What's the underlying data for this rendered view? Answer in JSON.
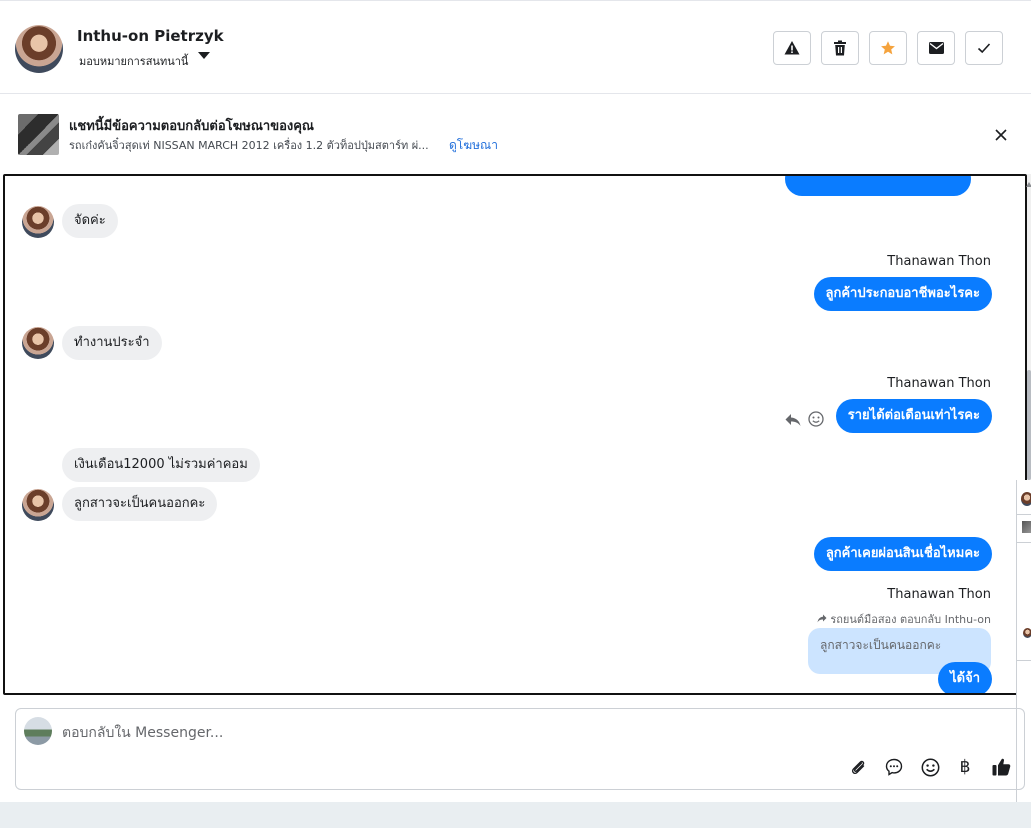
{
  "header": {
    "contact_name": "Inthu-on Pietrzyk",
    "assign_label": "มอบหมายการสนทนานี้",
    "actions": [
      "mark-spam",
      "delete",
      "star",
      "mark-unread",
      "mark-done"
    ],
    "star_color": "#f5a33d"
  },
  "ad": {
    "title": "แชทนี้มีข้อความตอบกลับต่อโฆษณาของคุณ",
    "description": "รถเก๋งคันจิ๋วสุดเท่ NISSAN MARCH 2012 เครื่อง 1.2 ตัวท็อปปุ่มสตาร์ท ผ่...",
    "link_label": "ดูโฆษณา"
  },
  "messages": {
    "m1": "จัดค่ะ",
    "sender_a": "Thanawan Thon",
    "m2": "ลูกค้าประกอบอาชีพอะไรคะ",
    "m3": "ทำงานประจำ",
    "sender_b": "Thanawan Thon",
    "m4": "รายได้ต่อเดือนเท่าไรคะ",
    "m5": "เงินเดือน12000 ไม่รวมค่าคอม",
    "m6": "ลูกสาวจะเป็นคนออกคะ",
    "m7": "ลูกค้าเคยผ่อนสินเชื่อไหมคะ",
    "sender_c": "Thanawan Thon",
    "reply_meta": "รถยนต์มือสอง ตอบกลับ Inthu-on",
    "quoted": "ลูกสาวจะเป็นคนออกคะ",
    "m8": "ได้จ้า",
    "outgoing_color": "#0a7cff"
  },
  "composer": {
    "placeholder": "ตอบกลับใน Messenger...",
    "baht_symbol": "฿"
  }
}
